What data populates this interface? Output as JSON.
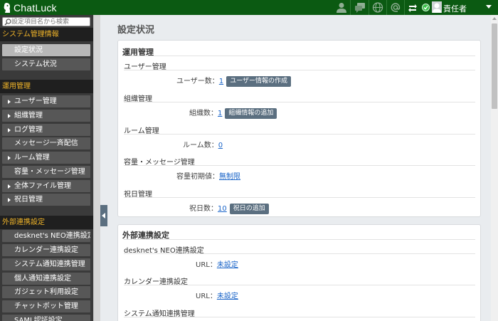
{
  "app": {
    "name": "ChatLuck"
  },
  "header": {
    "user_name": "責任者"
  },
  "search": {
    "placeholder": "設定項目名から検索"
  },
  "sidebar": {
    "section_system": "システム管理情報",
    "system_items": [
      "設定状況",
      "システム状況"
    ],
    "section_ops": "運用管理",
    "ops_items": [
      {
        "label": "ユーザー管理",
        "arrow": true
      },
      {
        "label": "組織管理",
        "arrow": true
      },
      {
        "label": "ログ管理",
        "arrow": true
      },
      {
        "label": "メッセージ一斉配信",
        "arrow": false
      },
      {
        "label": "ルーム管理",
        "arrow": true
      },
      {
        "label": "容量・メッセージ管理",
        "arrow": false
      },
      {
        "label": "全体ファイル管理",
        "arrow": true
      },
      {
        "label": "祝日管理",
        "arrow": true
      }
    ],
    "section_ext": "外部連携設定",
    "ext_items": [
      "desknet's NEO連携設定",
      "カレンダー連携設定",
      "システム通知連携管理",
      "個人通知連携設定",
      "ガジェット利用設定",
      "チャットボット管理",
      "SAML認証設定"
    ]
  },
  "main": {
    "page_title": "設定状況",
    "ops_panel": {
      "title": "運用管理",
      "user": {
        "title": "ユーザー管理",
        "label": "ユーザー数：",
        "value": "1",
        "button": "ユーザー情報の作成"
      },
      "org": {
        "title": "組織管理",
        "label": "組織数：",
        "value": "1",
        "button": "組織情報の追加"
      },
      "room": {
        "title": "ルーム管理",
        "label": "ルーム数：",
        "value": "0"
      },
      "capacity": {
        "title": "容量・メッセージ管理",
        "label": "容量初期値：",
        "value": "無制限"
      },
      "holiday": {
        "title": "祝日管理",
        "label": "祝日数：",
        "value": "10",
        "button": "祝日の追加"
      }
    },
    "ext_panel": {
      "title": "外部連携設定",
      "neo": {
        "title": "desknet's NEO連携設定",
        "label": "URL：",
        "value": "未設定"
      },
      "calendar": {
        "title": "カレンダー連携設定",
        "label": "URL：",
        "value": "未設定"
      },
      "sysnotify": {
        "title": "システム通知連携管理"
      }
    }
  }
}
